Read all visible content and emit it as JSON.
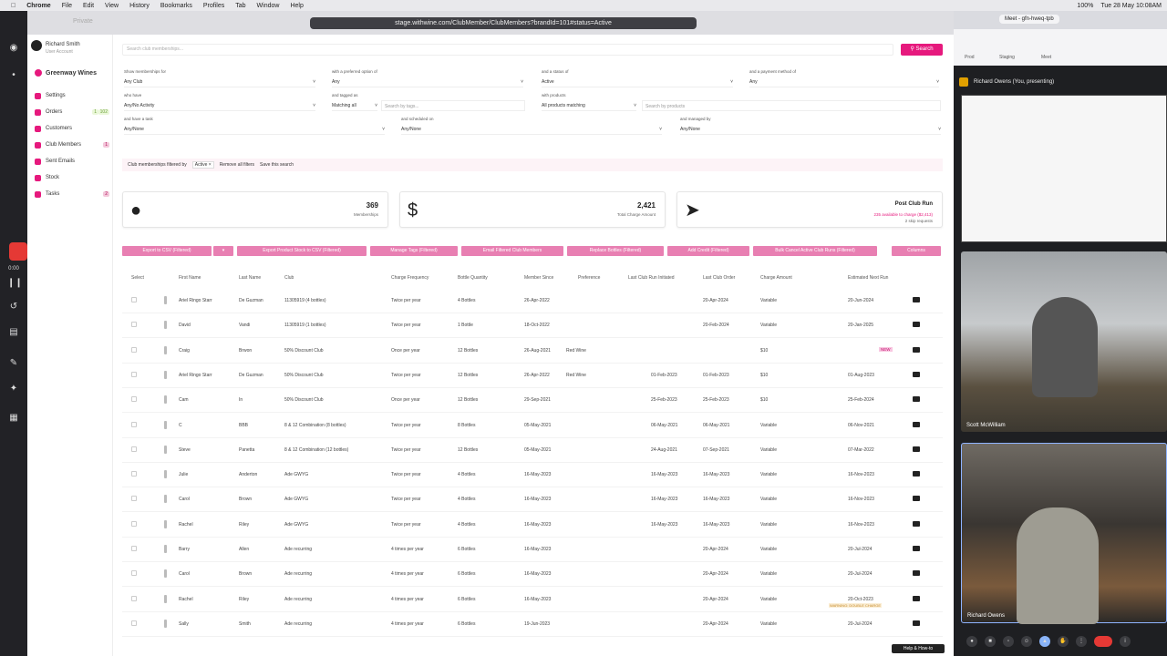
{
  "menubar": {
    "items": [
      "Chrome",
      "File",
      "Edit",
      "View",
      "History",
      "Bookmarks",
      "Profiles",
      "Tab",
      "Window",
      "Help"
    ],
    "right": [
      "100%",
      "Tue 28 May 10:08AM"
    ]
  },
  "browser": {
    "url": "stage.withwine.com/ClubMember/ClubMembers?brandId=101#status=Active",
    "tab_private": "Private"
  },
  "sidebar": {
    "user_name": "Richard Smith",
    "user_sub": "User Account",
    "brand": "Greenway Wines",
    "items": [
      {
        "label": "Settings",
        "badge": "",
        "badge2": ""
      },
      {
        "label": "Orders",
        "badge": "1",
        "badge2": "102"
      },
      {
        "label": "Customers",
        "badge": "",
        "badge2": ""
      },
      {
        "label": "Club Members",
        "badge": "1",
        "badge2": ""
      },
      {
        "label": "Sent Emails",
        "badge": "",
        "badge2": ""
      },
      {
        "label": "Stock",
        "badge": "",
        "badge2": ""
      },
      {
        "label": "Tasks",
        "badge": "2",
        "badge2": ""
      }
    ]
  },
  "search": {
    "placeholder": "Search club memberships...",
    "button": "Search"
  },
  "filters": [
    {
      "label": "Show memberships for",
      "value": "Any Club"
    },
    {
      "label": "with a preferred option of",
      "value": "Any"
    },
    {
      "label": "and a status of",
      "value": "Active"
    },
    {
      "label": "and a payment method of",
      "value": "Any"
    },
    {
      "label": "who have",
      "value": "Any/No Activity"
    },
    {
      "label": "and tagged as",
      "value": "Matching all"
    },
    {
      "label": "",
      "value": "Search by tags..."
    },
    {
      "label": "with products",
      "value": "All products matching"
    },
    {
      "label": "",
      "value": "Search by products"
    },
    {
      "label": "and have a task",
      "value": "Any/None"
    },
    {
      "label": "and scheduled on",
      "value": "Any/None"
    },
    {
      "label": "and managed by",
      "value": "Any/None"
    }
  ],
  "filter_bar": {
    "prefix": "Club memberships filtered by",
    "chip": "Active ×",
    "remove": "Remove all filters",
    "save": "Save this search"
  },
  "stats": [
    {
      "number": "369",
      "label": "Memberships"
    },
    {
      "number": "2,421",
      "label": "Total Charge Amount"
    },
    {
      "number": "Post Club Run",
      "label": "235 available to charge ($2,413)",
      "label2": "2 skip requests"
    }
  ],
  "actions": [
    "Export to CSV (Filtered)",
    "▾",
    "Export Product Stock to CSV (Filtered)",
    "Manage Tags (Filtered)",
    "Email Filtered Club Members",
    "Replace Bottles (Filtered)",
    "Add Credit (Filtered)",
    "Bulk Cancel Active Club Runs (Filtered)",
    "Columns"
  ],
  "columns": [
    "Select",
    "First Name",
    "Last Name",
    "Club",
    "Charge Frequency",
    "Bottle Quantity",
    "Member Since",
    "Preference",
    "Last Club Run Initiated",
    "Last Club Order",
    "Charge Amount",
    "Estimated Next Run"
  ],
  "rows": [
    [
      "Ariel Ringo Starr",
      "De Guzman",
      "11305919 (4 bottles)",
      "Twice per year",
      "4 Bottles",
      "26-Apr-2022",
      "",
      "",
      "20-Apr-2024",
      "Variable",
      "20-Jun-2024"
    ],
    [
      "David",
      "Vandi",
      "11305919 (1 bottles)",
      "Twice per year",
      "1 Bottle",
      "18-Oct-2022",
      "",
      "",
      "20-Feb-2024",
      "Variable",
      "20-Jan-2025"
    ],
    [
      "Craig",
      "Brwon",
      "50% Discount Club",
      "Once per year",
      "12 Bottles",
      "26-Aug-2021",
      "Red Wine",
      "",
      "",
      "$10",
      "NEW"
    ],
    [
      "Ariel Ringo Starr",
      "De Guzman",
      "50% Discount Club",
      "Twice per year",
      "12 Bottles",
      "26-Apr-2022",
      "Red Wine",
      "01-Feb-2023",
      "01-Feb-2023",
      "$10",
      "01-Aug-2023"
    ],
    [
      "Cam",
      "In",
      "50% Discount Club",
      "Once per year",
      "12 Bottles",
      "29-Sep-2021",
      "",
      "25-Feb-2023",
      "25-Feb-2023",
      "$10",
      "25-Feb-2024"
    ],
    [
      "C",
      "BBB",
      "8 & 12 Combination (8 bottles)",
      "Twice per year",
      "8 Bottles",
      "05-May-2021",
      "",
      "06-May-2021",
      "06-May-2021",
      "Variable",
      "06-Nov-2021"
    ],
    [
      "Steve",
      "Panetta",
      "8 & 12 Combination (12 bottles)",
      "Twice per year",
      "12 Bottles",
      "05-May-2021",
      "",
      "24-Aug-2021",
      "07-Sep-2021",
      "Variable",
      "07-Mar-2022"
    ],
    [
      "Julie",
      "Anderton",
      "Ade GWYG",
      "Twice per year",
      "4 Bottles",
      "16-May-2023",
      "",
      "16-May-2023",
      "16-May-2023",
      "Variable",
      "16-Nov-2023"
    ],
    [
      "Carol",
      "Brown",
      "Ade GWYG",
      "Twice per year",
      "4 Bottles",
      "16-May-2023",
      "",
      "16-May-2023",
      "16-May-2023",
      "Variable",
      "16-Nov-2023"
    ],
    [
      "Rachel",
      "Riley",
      "Ade GWYG",
      "Twice per year",
      "4 Bottles",
      "16-May-2023",
      "",
      "16-May-2023",
      "16-May-2023",
      "Variable",
      "16-Nov-2023"
    ],
    [
      "Barry",
      "Allen",
      "Ade recurring",
      "4 times per year",
      "6 Bottles",
      "16-May-2023",
      "",
      "",
      "20-Apr-2024",
      "Variable",
      "20-Jul-2024"
    ],
    [
      "Carol",
      "Brown",
      "Ade recurring",
      "4 times per year",
      "6 Bottles",
      "16-May-2023",
      "",
      "",
      "20-Apr-2024",
      "Variable",
      "20-Jul-2024"
    ],
    [
      "Rachel",
      "Riley",
      "Ade recurring",
      "4 times per year",
      "6 Bottles",
      "16-May-2023",
      "",
      "",
      "20-Apr-2024",
      "Variable",
      "20-Oct-2023"
    ],
    [
      "Sally",
      "Smith",
      "Ade recurring",
      "4 times per year",
      "6 Bottles",
      "19-Jun-2023",
      "",
      "",
      "20-Apr-2024",
      "Variable",
      "20-Jul-2024"
    ]
  ],
  "row_warning": "WARNING: DOUBLE CHARGE",
  "meet": {
    "tab": "Meet - gfn-hweq-tpb",
    "bookmarks": [
      "Prod",
      "Staging",
      "Meet"
    ],
    "presenting": "Richard Owens (You, presenting)",
    "person1": "Scott McWilliam",
    "person2": "Richard Owens"
  },
  "help": "Help & How-to",
  "colors": {
    "accent": "#e6197d",
    "accent_light": "#e87fb2"
  }
}
